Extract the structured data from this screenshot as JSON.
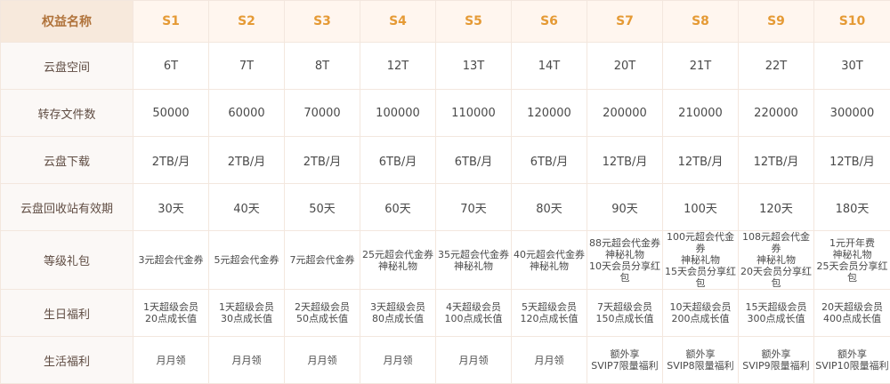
{
  "table": {
    "headers": [
      "权益名称",
      "S1",
      "S2",
      "S3",
      "S4",
      "S5",
      "S6",
      "S7",
      "S8",
      "S9",
      "S10"
    ],
    "rows": [
      {
        "label": "云盘空间",
        "cells": [
          [
            "6T"
          ],
          [
            "7T"
          ],
          [
            "8T"
          ],
          [
            "12T"
          ],
          [
            "13T"
          ],
          [
            "14T"
          ],
          [
            "20T"
          ],
          [
            "21T"
          ],
          [
            "22T"
          ],
          [
            "30T"
          ]
        ]
      },
      {
        "label": "转存文件数",
        "cells": [
          [
            "50000"
          ],
          [
            "60000"
          ],
          [
            "70000"
          ],
          [
            "100000"
          ],
          [
            "110000"
          ],
          [
            "120000"
          ],
          [
            "200000"
          ],
          [
            "210000"
          ],
          [
            "220000"
          ],
          [
            "300000"
          ]
        ]
      },
      {
        "label": "云盘下载",
        "cells": [
          [
            "2TB/月"
          ],
          [
            "2TB/月"
          ],
          [
            "2TB/月"
          ],
          [
            "6TB/月"
          ],
          [
            "6TB/月"
          ],
          [
            "6TB/月"
          ],
          [
            "12TB/月"
          ],
          [
            "12TB/月"
          ],
          [
            "12TB/月"
          ],
          [
            "12TB/月"
          ]
        ]
      },
      {
        "label": "云盘回收站有效期",
        "cells": [
          [
            "30天"
          ],
          [
            "40天"
          ],
          [
            "50天"
          ],
          [
            "60天"
          ],
          [
            "70天"
          ],
          [
            "80天"
          ],
          [
            "90天"
          ],
          [
            "100天"
          ],
          [
            "120天"
          ],
          [
            "180天"
          ]
        ]
      },
      {
        "label": "等级礼包",
        "cells": [
          [
            "3元超会代金券"
          ],
          [
            "5元超会代金券"
          ],
          [
            "7元超会代金券"
          ],
          [
            "25元超会代金券",
            "神秘礼物"
          ],
          [
            "35元超会代金券",
            "神秘礼物"
          ],
          [
            "40元超会代金券",
            "神秘礼物"
          ],
          [
            "88元超会代金券",
            "神秘礼物",
            "10天会员分享红包"
          ],
          [
            "100元超会代金券",
            "神秘礼物",
            "15天会员分享红包"
          ],
          [
            "108元超会代金券",
            "神秘礼物",
            "20天会员分享红包"
          ],
          [
            "1元开年费",
            "神秘礼物",
            "25天会员分享红包"
          ]
        ]
      },
      {
        "label": "生日福利",
        "cells": [
          [
            "1天超级会员",
            "20点成长值"
          ],
          [
            "1天超级会员",
            "30点成长值"
          ],
          [
            "2天超级会员",
            "50点成长值"
          ],
          [
            "3天超级会员",
            "80点成长值"
          ],
          [
            "4天超级会员",
            "100点成长值"
          ],
          [
            "5天超级会员",
            "120点成长值"
          ],
          [
            "7天超级会员",
            "150点成长值"
          ],
          [
            "10天超级会员",
            "200点成长值"
          ],
          [
            "15天超级会员",
            "300点成长值"
          ],
          [
            "20天超级会员",
            "400点成长值"
          ]
        ]
      },
      {
        "label": "生活福利",
        "cells": [
          [
            "月月领"
          ],
          [
            "月月领"
          ],
          [
            "月月领"
          ],
          [
            "月月领"
          ],
          [
            "月月领"
          ],
          [
            "月月领"
          ],
          [
            "额外享",
            "SVIP7限量福利"
          ],
          [
            "额外享",
            "SVIP8限量福利"
          ],
          [
            "额外享",
            "SVIP9限量福利"
          ],
          [
            "额外享",
            "SVIP10限量福利"
          ]
        ]
      }
    ]
  }
}
